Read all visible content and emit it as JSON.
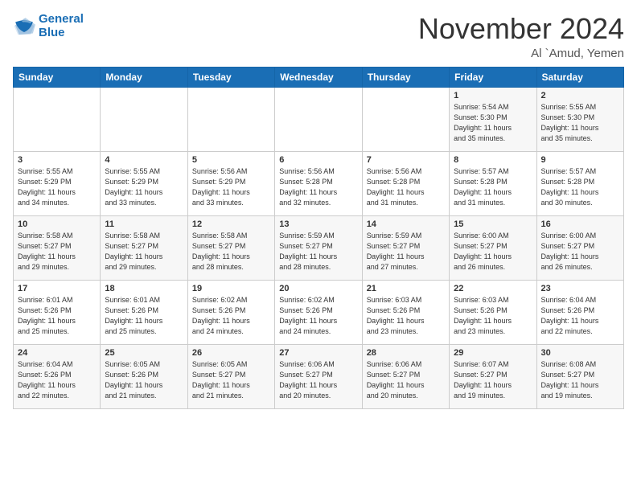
{
  "header": {
    "logo_line1": "General",
    "logo_line2": "Blue",
    "month": "November 2024",
    "location": "Al `Amud, Yemen"
  },
  "days_of_week": [
    "Sunday",
    "Monday",
    "Tuesday",
    "Wednesday",
    "Thursday",
    "Friday",
    "Saturday"
  ],
  "weeks": [
    [
      {
        "num": "",
        "info": ""
      },
      {
        "num": "",
        "info": ""
      },
      {
        "num": "",
        "info": ""
      },
      {
        "num": "",
        "info": ""
      },
      {
        "num": "",
        "info": ""
      },
      {
        "num": "1",
        "info": "Sunrise: 5:54 AM\nSunset: 5:30 PM\nDaylight: 11 hours\nand 35 minutes."
      },
      {
        "num": "2",
        "info": "Sunrise: 5:55 AM\nSunset: 5:30 PM\nDaylight: 11 hours\nand 35 minutes."
      }
    ],
    [
      {
        "num": "3",
        "info": "Sunrise: 5:55 AM\nSunset: 5:29 PM\nDaylight: 11 hours\nand 34 minutes."
      },
      {
        "num": "4",
        "info": "Sunrise: 5:55 AM\nSunset: 5:29 PM\nDaylight: 11 hours\nand 33 minutes."
      },
      {
        "num": "5",
        "info": "Sunrise: 5:56 AM\nSunset: 5:29 PM\nDaylight: 11 hours\nand 33 minutes."
      },
      {
        "num": "6",
        "info": "Sunrise: 5:56 AM\nSunset: 5:28 PM\nDaylight: 11 hours\nand 32 minutes."
      },
      {
        "num": "7",
        "info": "Sunrise: 5:56 AM\nSunset: 5:28 PM\nDaylight: 11 hours\nand 31 minutes."
      },
      {
        "num": "8",
        "info": "Sunrise: 5:57 AM\nSunset: 5:28 PM\nDaylight: 11 hours\nand 31 minutes."
      },
      {
        "num": "9",
        "info": "Sunrise: 5:57 AM\nSunset: 5:28 PM\nDaylight: 11 hours\nand 30 minutes."
      }
    ],
    [
      {
        "num": "10",
        "info": "Sunrise: 5:58 AM\nSunset: 5:27 PM\nDaylight: 11 hours\nand 29 minutes."
      },
      {
        "num": "11",
        "info": "Sunrise: 5:58 AM\nSunset: 5:27 PM\nDaylight: 11 hours\nand 29 minutes."
      },
      {
        "num": "12",
        "info": "Sunrise: 5:58 AM\nSunset: 5:27 PM\nDaylight: 11 hours\nand 28 minutes."
      },
      {
        "num": "13",
        "info": "Sunrise: 5:59 AM\nSunset: 5:27 PM\nDaylight: 11 hours\nand 28 minutes."
      },
      {
        "num": "14",
        "info": "Sunrise: 5:59 AM\nSunset: 5:27 PM\nDaylight: 11 hours\nand 27 minutes."
      },
      {
        "num": "15",
        "info": "Sunrise: 6:00 AM\nSunset: 5:27 PM\nDaylight: 11 hours\nand 26 minutes."
      },
      {
        "num": "16",
        "info": "Sunrise: 6:00 AM\nSunset: 5:27 PM\nDaylight: 11 hours\nand 26 minutes."
      }
    ],
    [
      {
        "num": "17",
        "info": "Sunrise: 6:01 AM\nSunset: 5:26 PM\nDaylight: 11 hours\nand 25 minutes."
      },
      {
        "num": "18",
        "info": "Sunrise: 6:01 AM\nSunset: 5:26 PM\nDaylight: 11 hours\nand 25 minutes."
      },
      {
        "num": "19",
        "info": "Sunrise: 6:02 AM\nSunset: 5:26 PM\nDaylight: 11 hours\nand 24 minutes."
      },
      {
        "num": "20",
        "info": "Sunrise: 6:02 AM\nSunset: 5:26 PM\nDaylight: 11 hours\nand 24 minutes."
      },
      {
        "num": "21",
        "info": "Sunrise: 6:03 AM\nSunset: 5:26 PM\nDaylight: 11 hours\nand 23 minutes."
      },
      {
        "num": "22",
        "info": "Sunrise: 6:03 AM\nSunset: 5:26 PM\nDaylight: 11 hours\nand 23 minutes."
      },
      {
        "num": "23",
        "info": "Sunrise: 6:04 AM\nSunset: 5:26 PM\nDaylight: 11 hours\nand 22 minutes."
      }
    ],
    [
      {
        "num": "24",
        "info": "Sunrise: 6:04 AM\nSunset: 5:26 PM\nDaylight: 11 hours\nand 22 minutes."
      },
      {
        "num": "25",
        "info": "Sunrise: 6:05 AM\nSunset: 5:26 PM\nDaylight: 11 hours\nand 21 minutes."
      },
      {
        "num": "26",
        "info": "Sunrise: 6:05 AM\nSunset: 5:27 PM\nDaylight: 11 hours\nand 21 minutes."
      },
      {
        "num": "27",
        "info": "Sunrise: 6:06 AM\nSunset: 5:27 PM\nDaylight: 11 hours\nand 20 minutes."
      },
      {
        "num": "28",
        "info": "Sunrise: 6:06 AM\nSunset: 5:27 PM\nDaylight: 11 hours\nand 20 minutes."
      },
      {
        "num": "29",
        "info": "Sunrise: 6:07 AM\nSunset: 5:27 PM\nDaylight: 11 hours\nand 19 minutes."
      },
      {
        "num": "30",
        "info": "Sunrise: 6:08 AM\nSunset: 5:27 PM\nDaylight: 11 hours\nand 19 minutes."
      }
    ]
  ]
}
